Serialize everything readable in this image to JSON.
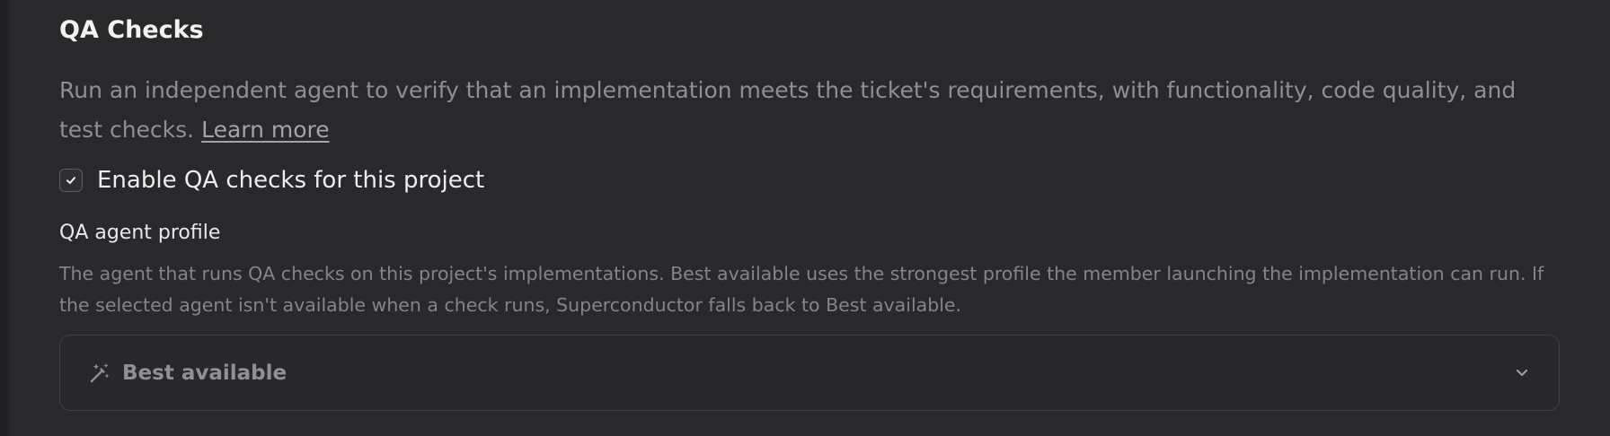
{
  "section": {
    "title": "QA Checks",
    "description": "Run an independent agent to verify that an implementation meets the ticket's requirements, with functionality, code quality, and test checks.",
    "learn_more_label": "Learn more"
  },
  "enable_checkbox": {
    "label": "Enable QA checks for this project",
    "checked": true
  },
  "agent_profile": {
    "label": "QA agent profile",
    "help_text": "The agent that runs QA checks on this project's implementations. Best available uses the strongest profile the member launching the implementation can run. If the selected agent isn't available when a check runs, Superconductor falls back to Best available.",
    "selected_value": "Best available",
    "value_icon": "magic-wand-icon",
    "dropdown_icon": "chevron-down-icon"
  },
  "colors": {
    "background": "#29292c",
    "title": "#f2f2f3",
    "muted_text": "#8e8e96",
    "select_border": "#3f3f45"
  }
}
